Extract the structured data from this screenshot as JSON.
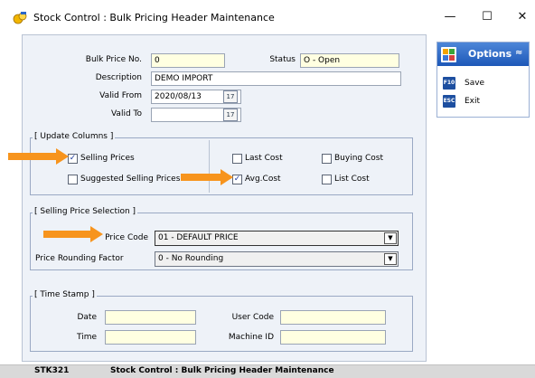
{
  "window": {
    "title": "Stock Control : Bulk Pricing Header Maintenance",
    "minimize": "—",
    "maximize": "☐",
    "close": "✕"
  },
  "header": {
    "bulk_price_no_label": "Bulk Price No.",
    "bulk_price_no_value": "0",
    "status_label": "Status",
    "status_value": "O - Open",
    "description_label": "Description",
    "description_value": "DEMO IMPORT",
    "valid_from_label": "Valid From",
    "valid_from_value": "2020/08/13",
    "valid_to_label": "Valid To",
    "valid_to_value": ""
  },
  "update_columns": {
    "title": "[ Update Columns ]",
    "selling_prices": {
      "label": "Selling Prices",
      "checked": true
    },
    "suggested_selling_prices": {
      "label": "Suggested Selling Prices",
      "checked": false
    },
    "last_cost": {
      "label": "Last Cost",
      "checked": false
    },
    "avg_cost": {
      "label": "Avg.Cost",
      "checked": true
    },
    "buying_cost": {
      "label": "Buying Cost",
      "checked": false
    },
    "list_cost": {
      "label": "List Cost",
      "checked": false
    }
  },
  "selling_price_selection": {
    "title": "[ Selling Price Selection ]",
    "price_code_label": "Price Code",
    "price_code_value": "01 - DEFAULT PRICE",
    "rounding_label": "Price Rounding Factor",
    "rounding_value": "0 - No Rounding"
  },
  "time_stamp": {
    "title": "[ Time Stamp ]",
    "date_label": "Date",
    "date_value": "",
    "time_label": "Time",
    "time_value": "",
    "user_code_label": "User Code",
    "user_code_value": "",
    "machine_id_label": "Machine ID",
    "machine_id_value": ""
  },
  "options": {
    "title": "Options",
    "collapse_glyph": "≈",
    "items": [
      {
        "key": "F10",
        "label": "Save"
      },
      {
        "key": "ESC",
        "label": "Exit"
      }
    ]
  },
  "statusbar": {
    "program_code": "STK321",
    "program_title": "Stock Control : Bulk Pricing Header Maintenance"
  },
  "glyphs": {
    "check": "✓",
    "dropdown": "▼",
    "calendar": "17"
  },
  "colors": {
    "accent_arrow": "#f7941d",
    "options_header": "#1d58b8",
    "input_yellow": "#ffffe1",
    "panel_bg": "#eef2f8"
  }
}
